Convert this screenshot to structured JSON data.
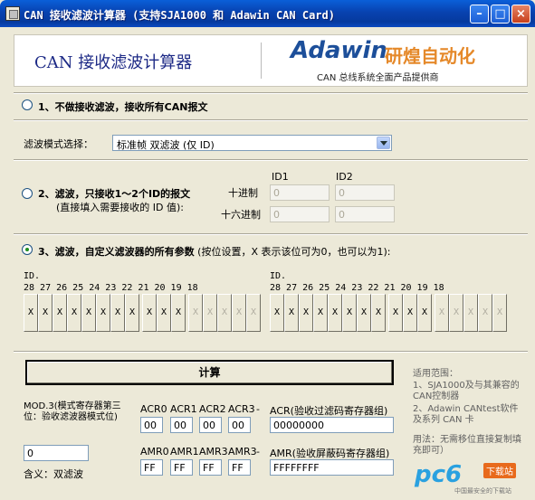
{
  "window": {
    "title": "CAN 接收滤波计算器 (支持SJA1000 和 Adawin CAN Card)"
  },
  "banner": {
    "title": "CAN 接收滤波计算器",
    "brand": "Adawin",
    "brand_cn": "研煌自动化",
    "subtitle": "CAN 总线系统全面产品提供商"
  },
  "option1": {
    "label": "1、不做接收滤波，接收所有CAN报文"
  },
  "filter_mode": {
    "label": "滤波模式选择：",
    "value": "标准帧 双滤波 (仅 ID)"
  },
  "option2": {
    "label": "2、滤波，只接收1～2个ID的报文",
    "sublabel": "(直接填入需要接收的 ID 值):",
    "dec_label": "十进制",
    "hex_label": "十六进制",
    "id1_header": "ID1",
    "id2_header": "ID2",
    "id1_dec": "0",
    "id2_dec": "0",
    "id1_hex": "0",
    "id2_hex": "0"
  },
  "option3": {
    "label_bold": "3、滤波，自定义滤波器的所有参数",
    "label_rest": "(按位设置，X 表示该位可为0，也可以为1):"
  },
  "bitfield": {
    "id_prefix": "ID.",
    "left_numbers": "28 27 26 25 24 23 22 21   20 19 18",
    "right_numbers": "28 27 26 25 24 23 22 21   20 19 18",
    "left_bits": [
      "X",
      "X",
      "X",
      "X",
      "X",
      "X",
      "X",
      "X",
      "X",
      "X",
      "X",
      "X",
      "X",
      "X",
      "X",
      "X"
    ],
    "right_bits": [
      "X",
      "X",
      "X",
      "X",
      "X",
      "X",
      "X",
      "X",
      "X",
      "X",
      "X",
      "X",
      "X",
      "X",
      "X",
      "X"
    ]
  },
  "calc_button": {
    "label": "计算"
  },
  "mode_box": {
    "label": "MOD.3(模式寄存器第三位：验收滤波器模式位)",
    "value": "0",
    "meaning": "含义：双滤波"
  },
  "acr": {
    "headers": [
      "ACR0",
      "ACR1",
      "ACR2",
      "ACR3"
    ],
    "values": [
      "00",
      "00",
      "00",
      "00"
    ],
    "combined_label": "ACR(验收过滤码寄存器组)",
    "combined_value": "00000000",
    "dash": "-"
  },
  "amr": {
    "headers": [
      "AMR0",
      "AMR1",
      "AMR3",
      "AMR3"
    ],
    "values": [
      "FF",
      "FF",
      "FF",
      "FF"
    ],
    "combined_label": "AMR(验收屏蔽码寄存器组)",
    "combined_value": "FFFFFFFF",
    "dash": "-"
  },
  "notes": {
    "scope_title": "适用范围：",
    "scope_1": "1、SJA1000及与其兼容的CAN控制器",
    "scope_2": "2、Adawin CANtest软件及系列 CAN 卡",
    "usage": "用法：无需移位直接复制填充即可）"
  },
  "watermark": {
    "text": "pc6",
    "tag": "下载站",
    "sub": "中国最安全的下载站"
  }
}
